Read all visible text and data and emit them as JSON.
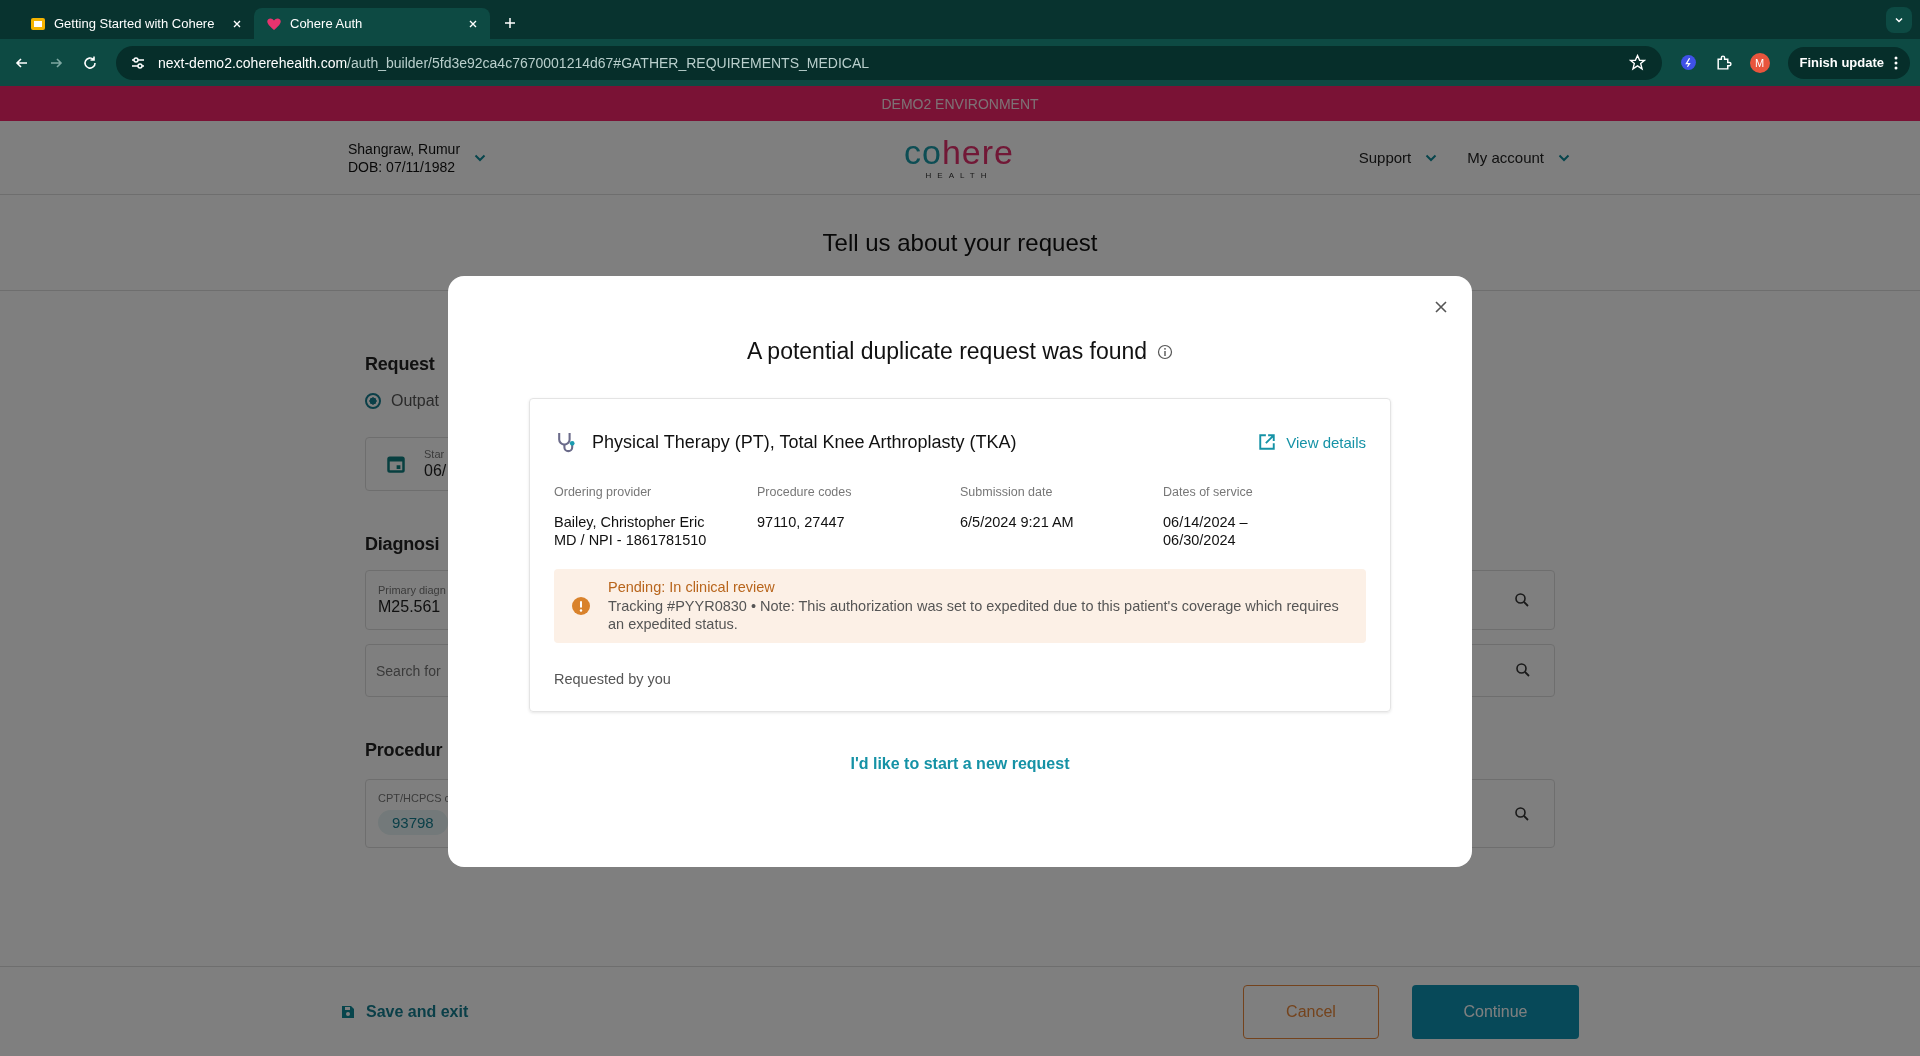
{
  "browser": {
    "tabs": [
      {
        "title": "Getting Started with Cohere",
        "kind": "doc",
        "selected": false
      },
      {
        "title": "Cohere Auth",
        "kind": "heart",
        "selected": true
      }
    ],
    "url": {
      "host": "next-demo2.coherehealth.com",
      "path": "/auth_builder/5fd3e92ca4c7670001214d67#GATHER_REQUIREMENTS_MEDICAL"
    },
    "profile_initial": "M",
    "update_button": "Finish update"
  },
  "banner": "DEMO2 ENVIRONMENT",
  "header": {
    "patient": {
      "name": "Shangraw, Rumur",
      "dob": "DOB: 07/11/1982"
    },
    "logo": {
      "part_a": "co",
      "part_b": "here",
      "sub": "HEALTH"
    },
    "nav": [
      "Support",
      "My account"
    ]
  },
  "page_title": "Tell us about your request",
  "form": {
    "request_heading": "Request",
    "radio": {
      "label": "Outpat",
      "selected": true
    },
    "date_field": {
      "label": "Star",
      "value": "06/"
    },
    "diagnosis_heading": "Diagnosi",
    "primary_field": {
      "label": "Primary diagn",
      "value": "M25.561"
    },
    "search_field": {
      "placeholder": "Search for"
    },
    "procedure_heading": "Procedur",
    "cpt_field": {
      "label": "CPT/HCPCS c",
      "chip": "93798"
    }
  },
  "modal": {
    "title": "A potential duplicate request was found",
    "card": {
      "title": "Physical Therapy (PT), Total Knee Arthroplasty (TKA)",
      "view_details": "View details",
      "fields": [
        {
          "label": "Ordering provider",
          "lines": [
            "Bailey, Christopher Eric",
            "MD / NPI - 1861781510"
          ]
        },
        {
          "label": "Procedure codes",
          "lines": [
            "97110, 27447"
          ]
        },
        {
          "label": "Submission date",
          "lines": [
            "6/5/2024 9:21 AM"
          ]
        },
        {
          "label": "Dates of service",
          "lines": [
            "06/14/2024 –",
            "06/30/2024"
          ]
        }
      ],
      "alert": {
        "status": "Pending: In clinical review",
        "text": "Tracking #PYYR0830 • Note: This authorization was set to expedited due to this patient's coverage which requires an expedited status."
      },
      "requested_by": "Requested by you"
    },
    "new_request_link": "I'd like to start a new request"
  },
  "footer": {
    "save_exit": "Save and exit",
    "cancel": "Cancel",
    "continue": "Continue"
  }
}
